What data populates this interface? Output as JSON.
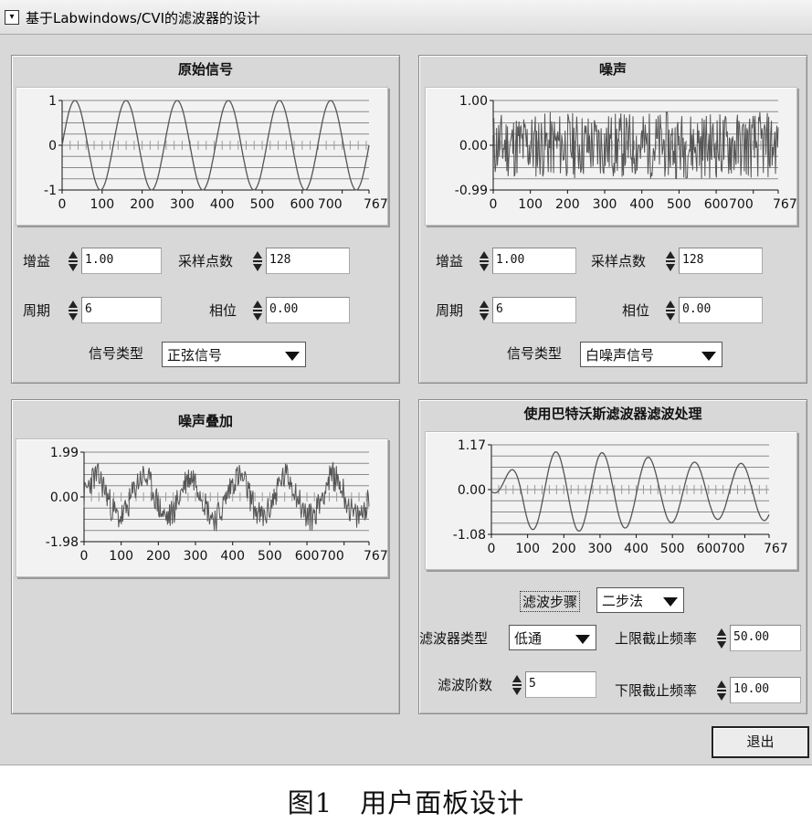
{
  "window": {
    "title": "基于Labwindows/CVI的滤波器的设计"
  },
  "panels": {
    "original": {
      "title": "原始信号",
      "gain_label": "增益",
      "gain_value": "1.00",
      "samples_label": "采样点数",
      "samples_value": "128",
      "period_label": "周期",
      "period_value": "6",
      "phase_label": "相位",
      "phase_value": "0.00",
      "type_label": "信号类型",
      "type_value": "正弦信号"
    },
    "noise": {
      "title": "噪声",
      "gain_label": "增益",
      "gain_value": "1.00",
      "samples_label": "采样点数",
      "samples_value": "128",
      "period_label": "周期",
      "period_value": "6",
      "phase_label": "相位",
      "phase_value": "0.00",
      "type_label": "信号类型",
      "type_value": "白噪声信号"
    },
    "mixed": {
      "title": "噪声叠加"
    },
    "filtered": {
      "title": "使用巴特沃斯滤波器滤波处理",
      "step_label": "滤波步骤",
      "step_value": "二步法",
      "filter_type_label": "滤波器类型",
      "filter_type_value": "低通",
      "upper_label": "上限截止频率",
      "upper_value": "50.00",
      "order_label": "滤波阶数",
      "order_value": "5",
      "lower_label": "下限截止频率",
      "lower_value": "10.00"
    }
  },
  "exit_label": "退出",
  "caption": "图1　用户面板设计",
  "chart_data": [
    {
      "id": "original",
      "type": "line",
      "title": "原始信号",
      "signal": "sine",
      "cycles": 6,
      "amplitude": 1,
      "x_ticks": [
        "0",
        "100",
        "200",
        "300",
        "400",
        "500",
        "600",
        "700",
        "767"
      ],
      "y_ticks": [
        "1",
        "0",
        "-1"
      ],
      "xlim": [
        0,
        767
      ],
      "ylim": [
        -1,
        1
      ],
      "grid": true
    },
    {
      "id": "noise",
      "type": "line",
      "title": "噪声",
      "signal": "white-noise",
      "x_ticks": [
        "0",
        "100",
        "200",
        "300",
        "400",
        "500",
        "600",
        "700",
        "767"
      ],
      "y_ticks": [
        "1.00",
        "0.00",
        "-0.99"
      ],
      "xlim": [
        0,
        767
      ],
      "ylim": [
        -0.99,
        1.0
      ],
      "grid": true
    },
    {
      "id": "mixed",
      "type": "line",
      "title": "噪声叠加",
      "signal": "sine-plus-noise",
      "cycles": 6,
      "x_ticks": [
        "0",
        "100",
        "200",
        "300",
        "400",
        "500",
        "600",
        "700",
        "767"
      ],
      "y_ticks": [
        "1.99",
        "0.00",
        "-1.98"
      ],
      "xlim": [
        0,
        767
      ],
      "ylim": [
        -1.98,
        1.99
      ],
      "grid": true
    },
    {
      "id": "filtered",
      "type": "line",
      "title": "使用巴特沃斯滤波器滤波处理",
      "signal": "filtered-sine",
      "cycles": 6,
      "x_ticks": [
        "0",
        "100",
        "200",
        "300",
        "400",
        "500",
        "600",
        "700",
        "767"
      ],
      "y_ticks": [
        "1.17",
        "0.00",
        "-1.08"
      ],
      "xlim": [
        0,
        767
      ],
      "ylim": [
        -1.08,
        1.17
      ],
      "grid": true
    }
  ]
}
